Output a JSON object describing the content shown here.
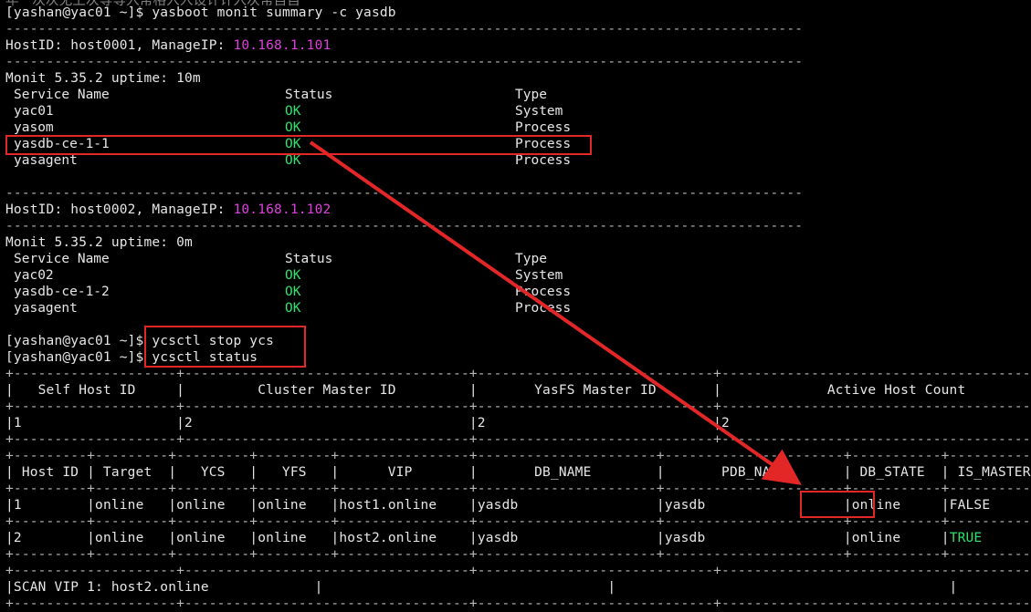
{
  "top_partial": "年一次次无上次等等入常格入入设计计入次常自自",
  "prompt": "[yashan@yac01 ~]$",
  "cmd1": "yasboot monit summary -c yasdb",
  "dash": "--------------------------------------------------------------------------------------------------",
  "host1": {
    "label": "HostID: host0001, ManageIP: ",
    "ip": "10.168.1.101"
  },
  "monit1": "Monit 5.35.2 uptime: 10m",
  "host2": {
    "label": "HostID: host0002, ManageIP: ",
    "ip": "10.168.1.102"
  },
  "monit2": "Monit 5.35.2 uptime: 0m",
  "svc_headers": {
    "name": "Service Name",
    "status": "Status",
    "type": "Type"
  },
  "svc1": [
    {
      "name": "yac01",
      "status": "OK",
      "type": "System"
    },
    {
      "name": "yasom",
      "status": "OK",
      "type": "Process"
    },
    {
      "name": "yasdb-ce-1-1",
      "status": "OK",
      "type": "Process"
    },
    {
      "name": "yasagent",
      "status": "OK",
      "type": "Process"
    }
  ],
  "svc2": [
    {
      "name": "yac02",
      "status": "OK",
      "type": "System"
    },
    {
      "name": "yasdb-ce-1-2",
      "status": "OK",
      "type": "Process"
    },
    {
      "name": "yasagent",
      "status": "OK",
      "type": "Process"
    }
  ],
  "cmd2": "ycsctl stop ycs",
  "cmd3": "ycsctl status",
  "t1_border": "+--------------------+-----------------------------------+-----------------------------+-----------------------------------------+",
  "t1_header": "|   Self Host ID     |         Cluster Master ID         |       YasFS Master ID       |             Active Host Count           |",
  "t1_row": "|1                   |2                                  |2                            |2                                        |",
  "t2_border": "+---------+---------+---------+---------+----------------+----------------------+----------------------+-----------+-----------+",
  "t2_header": "| Host ID | Target  |   YCS   |   YFS   |      VIP       |       DB_NAME        |       PDB_NAME       | DB_STATE  | IS_MASTER |",
  "t2_rows": [
    {
      "id": "1",
      "target": "online",
      "ycs": "online",
      "yfs": "online",
      "vip": "host1.online",
      "db": "yasdb",
      "pdb": "yasdb",
      "state": "online",
      "master": "FALSE"
    },
    {
      "id": "2",
      "target": "online",
      "ycs": "online",
      "yfs": "online",
      "vip": "host2.online",
      "db": "yasdb",
      "pdb": "yasdb",
      "state": "online",
      "master": "TRUE"
    }
  ],
  "scan_vip": "SCAN VIP 1: host2.online",
  "colors": {
    "ok": "#2fe36b",
    "ip": "#e040e0",
    "highlight": "#e32626"
  }
}
